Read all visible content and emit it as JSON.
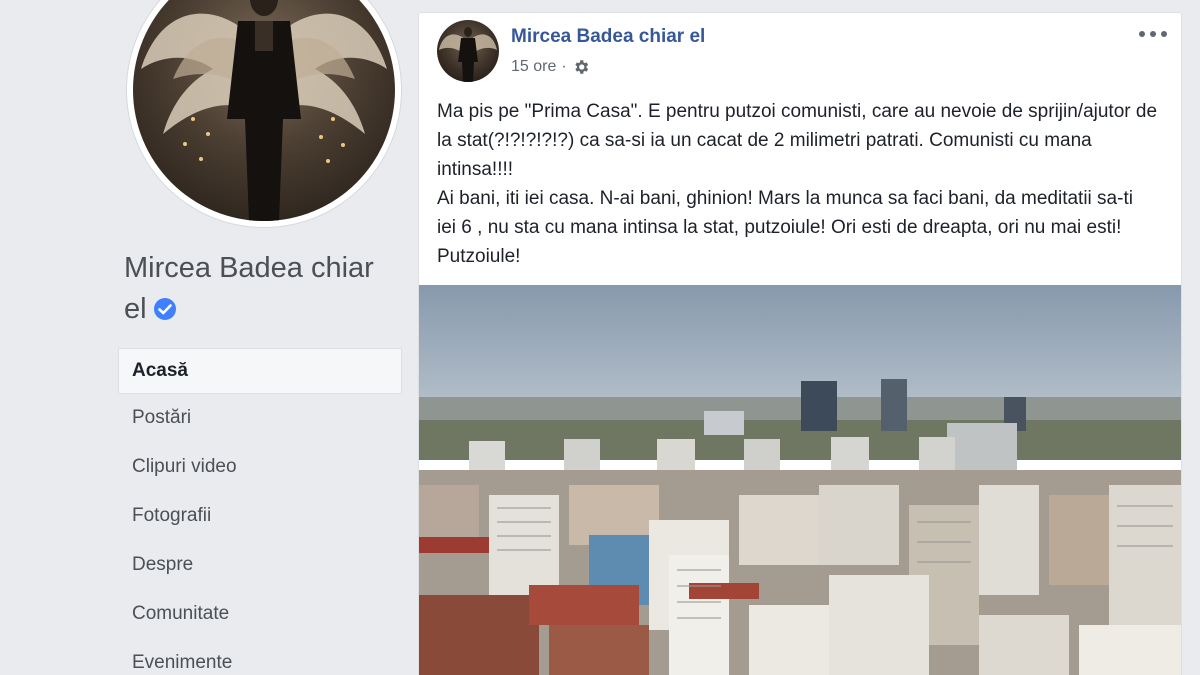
{
  "page": {
    "name": "Mircea Badea chiar el",
    "verified_icon": "verified-badge-icon"
  },
  "nav": {
    "items": [
      {
        "label": "Acasă",
        "active": true
      },
      {
        "label": "Postări"
      },
      {
        "label": "Clipuri video"
      },
      {
        "label": "Fotografii"
      },
      {
        "label": "Despre"
      },
      {
        "label": "Comunitate"
      },
      {
        "label": "Evenimente"
      }
    ]
  },
  "post": {
    "author": "Mircea Badea chiar el",
    "time": "15 ore",
    "separator": "·",
    "audience_icon": "gear-icon",
    "more_icon": "more-options-icon",
    "text": "Ma pis pe \"Prima Casa\". E pentru putzoi comunisti, care au nevoie de sprijin/ajutor de la stat(?!?!?!?!?) ca sa-si ia un cacat de 2 milimetri patrati. Comunisti cu mana intinsa!!!!\nAi bani, iti iei casa. N-ai bani, ghinion! Mars la munca sa faci bani, da meditatii sa-ti iei 6 , nu sta cu mana intinsa la stat, putzoiule! Ori esti de dreapta, ori nu mai esti! Putzoiule!",
    "image_description_icon": "city-skyline-photo"
  },
  "colors": {
    "link_blue": "#365899",
    "verified_blue": "#4080ff",
    "page_bg": "#e9ebee"
  }
}
